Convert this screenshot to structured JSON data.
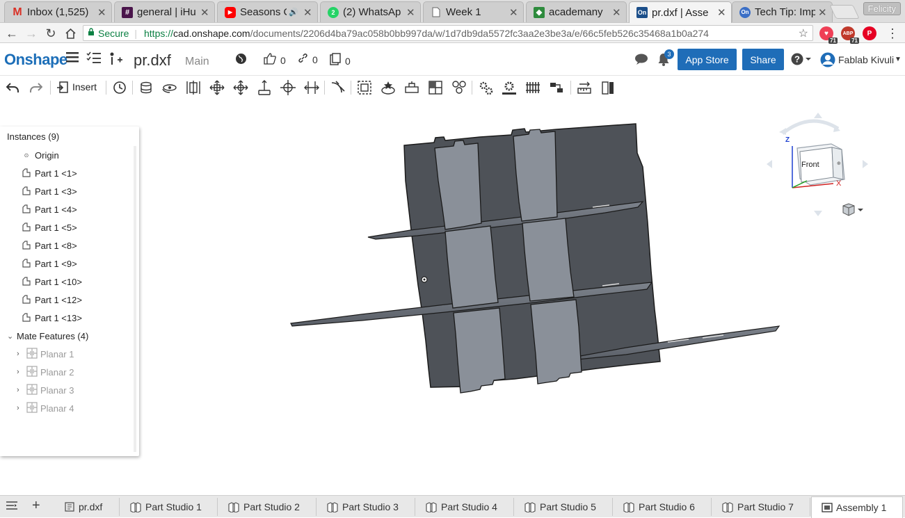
{
  "browser": {
    "tabs": [
      {
        "title": "Inbox (1,525)",
        "icon": "gmail-icon",
        "color": "#d93025"
      },
      {
        "title": "general | iHu",
        "icon": "slack-icon",
        "color": "#4a154b"
      },
      {
        "title": "Seasons Cl",
        "icon": "youtube-icon",
        "color": "#ff0000"
      },
      {
        "title": "(2) WhatsAp",
        "icon": "whatsapp-icon",
        "color": "#25d366"
      },
      {
        "title": "Week 1",
        "icon": "document-icon",
        "color": "#888888"
      },
      {
        "title": "academany",
        "icon": "academany-icon",
        "color": "#2e8b3d"
      },
      {
        "title": "pr.dxf | Asse",
        "icon": "onshape-icon",
        "color": "#1c4f8a"
      },
      {
        "title": "Tech Tip: Imp",
        "icon": "onshape-icon",
        "color": "#3b6fc6"
      }
    ],
    "profile": "Felicity",
    "secure_label": "Secure",
    "url_scheme": "https://",
    "url_host": "cad.onshape.com",
    "url_path": "/documents/2206d4ba79ac058b0bb997da/w/1d7db9da5572fc3aa2e3be3a/e/66c5feb526c35468a1b0a274",
    "extensions": [
      {
        "name": "pocket-icon",
        "badge": "71",
        "color": "#ef3f56"
      },
      {
        "name": "adblock-icon",
        "badge": "71",
        "color": "#c0392b"
      },
      {
        "name": "pinterest-icon",
        "badge": "",
        "color": "#e60023"
      }
    ]
  },
  "app": {
    "logo": "Onshape",
    "document_name": "pr.dxf",
    "branch": "Main",
    "likes": "0",
    "links": "0",
    "copies": "0",
    "notification_count": "3",
    "app_store_label": "App Store",
    "share_label": "Share",
    "user_name": "Fablab Kivuli",
    "accent": "#1f6db8"
  },
  "toolbar": {
    "insert_label": "Insert"
  },
  "instances": {
    "title": "Instances (9)",
    "origin": "Origin",
    "parts": [
      "Part 1 <1>",
      "Part 1 <3>",
      "Part 1 <4>",
      "Part 1 <5>",
      "Part 1 <8>",
      "Part 1 <9>",
      "Part 1 <10>",
      "Part 1 <12>",
      "Part 1 <13>"
    ],
    "mate_title": "Mate Features (4)",
    "mates": [
      "Planar 1",
      "Planar 2",
      "Planar 3",
      "Planar 4"
    ]
  },
  "viewcube": {
    "face": "Front",
    "axis_z": "Z",
    "axis_x": "X"
  },
  "bottom_tabs": [
    {
      "label": "pr.dxf",
      "type": "file"
    },
    {
      "label": "Part Studio 1",
      "type": "part"
    },
    {
      "label": "Part Studio 2",
      "type": "part"
    },
    {
      "label": "Part Studio 3",
      "type": "part"
    },
    {
      "label": "Part Studio 4",
      "type": "part"
    },
    {
      "label": "Part Studio 5",
      "type": "part"
    },
    {
      "label": "Part Studio 6",
      "type": "part"
    },
    {
      "label": "Part Studio 7",
      "type": "part"
    },
    {
      "label": "Assembly 1",
      "type": "assembly"
    }
  ]
}
